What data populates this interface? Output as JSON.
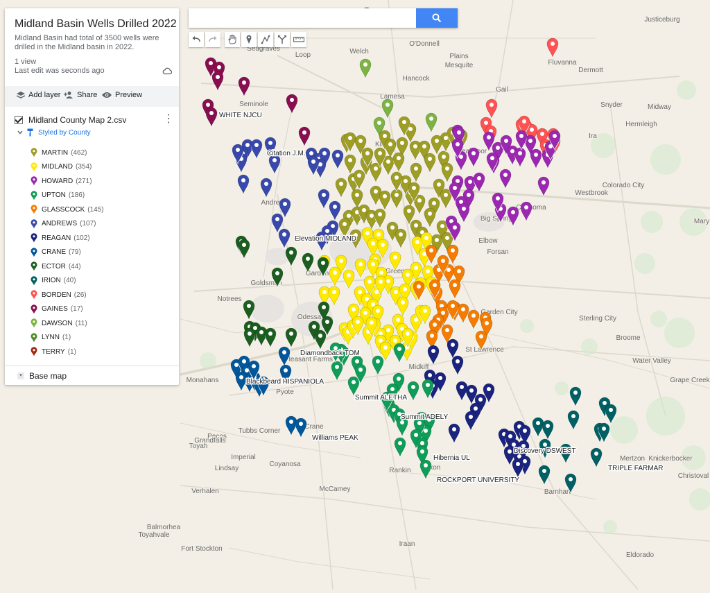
{
  "panel": {
    "title": "Midland Basin Wells Drilled 2022",
    "description": "Midland Basin had total of 3500 wells were drilled in the Midland basin in 2022.",
    "views": "1 view",
    "last_edit": "Last edit was seconds ago",
    "actions": {
      "add_layer": "Add layer",
      "share": "Share",
      "preview": "Preview"
    },
    "layer_name": "Midland County Map 2.csv",
    "styled_by": "Styled by County",
    "legend": [
      {
        "name": "MARTIN",
        "count": "(462)",
        "color": "#9e9d24"
      },
      {
        "name": "MIDLAND",
        "count": "(354)",
        "color": "#ffea00"
      },
      {
        "name": "HOWARD",
        "count": "(271)",
        "color": "#9c27b0"
      },
      {
        "name": "UPTON",
        "count": "(186)",
        "color": "#0f9d58"
      },
      {
        "name": "GLASSCOCK",
        "count": "(145)",
        "color": "#f57c00"
      },
      {
        "name": "ANDREWS",
        "count": "(107)",
        "color": "#3949ab"
      },
      {
        "name": "REAGAN",
        "count": "(102)",
        "color": "#1a237e"
      },
      {
        "name": "CRANE",
        "count": "(79)",
        "color": "#01579b"
      },
      {
        "name": "ECTOR",
        "count": "(44)",
        "color": "#1b5e20"
      },
      {
        "name": "IRION",
        "count": "(40)",
        "color": "#006064"
      },
      {
        "name": "BORDEN",
        "count": "(26)",
        "color": "#ff5252"
      },
      {
        "name": "GAINES",
        "count": "(17)",
        "color": "#880e4f"
      },
      {
        "name": "DAWSON",
        "count": "(11)",
        "color": "#7cb342"
      },
      {
        "name": "LYNN",
        "count": "(1)",
        "color": "#558b2f"
      },
      {
        "name": "TERRY",
        "count": "(1)",
        "color": "#a52714"
      }
    ],
    "base_map_label": "Base map"
  },
  "search": {
    "placeholder": ""
  },
  "map": {
    "towns": [
      "Seagraves",
      "Loop",
      "Welch",
      "O'Donnell",
      "Justiceburg",
      "Plains",
      "Mesquite",
      "Hancock",
      "Fluvanna",
      "Dermott",
      "Lamesa",
      "Gail",
      "Seminole",
      "Snyder",
      "Midway",
      "Hermleigh",
      "Ira",
      "Westbrook",
      "Colorado City",
      "Coahoma",
      "Big Spring",
      "Andrews",
      "Mary",
      "Forsan",
      "Elbow",
      "Goldsmith",
      "Notrees",
      "Odessa",
      "Garden City",
      "Sterling City",
      "Broome",
      "Water Valley",
      "Monahans",
      "Pyote",
      "Grape Creek",
      "Pecos",
      "Crane",
      "Tubbs Corner",
      "Grandfalls",
      "Lindsay",
      "Toyah",
      "Coyanosa",
      "Imperial",
      "Rankin",
      "Texon",
      "Mertzon",
      "Knickerbocker",
      "Christoval",
      "Barnhart",
      "Verhalen",
      "McCamey",
      "Balmorhea",
      "Toyahvale",
      "Fort Stockton",
      "Iraan",
      "Eldorado",
      "Kloh",
      "Vealmoor",
      "Midkiff",
      "St Lawrence",
      "Pleasant Farms",
      "Greenwood",
      "Gardendale"
    ],
    "labels": [
      "WHITE NJCU",
      "Citation J.M.",
      "Elevation MIDLAND",
      "Diamondback TOM",
      "Blackbeard HISPANIOLA",
      "Summit ALETHA",
      "Summit ADELY",
      "Williams PEAK",
      "Hibernia UL",
      "ROCKPORT UNIVERSITY",
      "Discovery DSWEST",
      "TRIPLE FARMAR"
    ]
  }
}
